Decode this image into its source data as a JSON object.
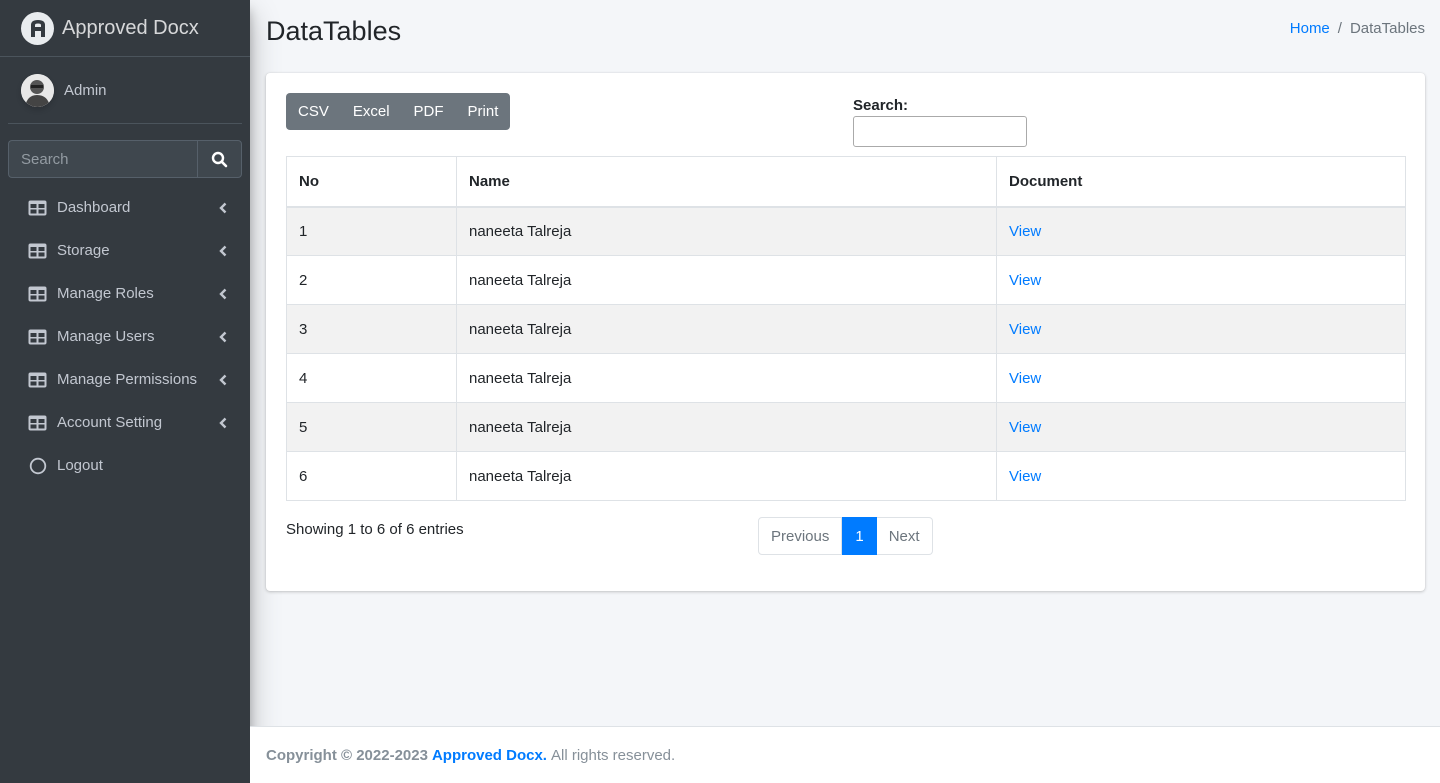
{
  "sidebar": {
    "brand": {
      "name": "Approved Docx",
      "logo_icon": "brand-logo-icon"
    },
    "user": {
      "name": "Admin",
      "avatar_icon": "user-avatar"
    },
    "search": {
      "placeholder": "Search",
      "icon": "search-icon"
    },
    "items": [
      {
        "label": "Dashboard",
        "icon": "table-icon",
        "has_submenu": true
      },
      {
        "label": "Storage",
        "icon": "table-icon",
        "has_submenu": true
      },
      {
        "label": "Manage Roles",
        "icon": "table-icon",
        "has_submenu": true
      },
      {
        "label": "Manage Users",
        "icon": "table-icon",
        "has_submenu": true
      },
      {
        "label": "Manage Permissions",
        "icon": "table-icon",
        "has_submenu": true
      },
      {
        "label": "Account Setting",
        "icon": "table-icon",
        "has_submenu": true
      },
      {
        "label": "Logout",
        "icon": "circle-icon",
        "has_submenu": false
      }
    ]
  },
  "header": {
    "title": "DataTables",
    "breadcrumb": {
      "home": "Home",
      "separator": "/",
      "current": "DataTables"
    }
  },
  "toolbar": {
    "buttons": [
      "CSV",
      "Excel",
      "PDF",
      "Print"
    ]
  },
  "search": {
    "label": "Search:",
    "value": ""
  },
  "table": {
    "columns": [
      "No",
      "Name",
      "Document"
    ],
    "rows": [
      {
        "no": "1",
        "name": "naneeta Talreja",
        "document": "View"
      },
      {
        "no": "2",
        "name": "naneeta Talreja",
        "document": "View"
      },
      {
        "no": "3",
        "name": "naneeta Talreja",
        "document": "View"
      },
      {
        "no": "4",
        "name": "naneeta Talreja",
        "document": "View"
      },
      {
        "no": "5",
        "name": "naneeta Talreja",
        "document": "View"
      },
      {
        "no": "6",
        "name": "naneeta Talreja",
        "document": "View"
      }
    ]
  },
  "info": "Showing 1 to 6 of 6 entries",
  "pagination": {
    "previous": "Previous",
    "current": "1",
    "next": "Next"
  },
  "footer": {
    "copyright": "Copyright © 2022-2023",
    "brand": "Approved Docx.",
    "rights": "All rights reserved."
  },
  "colors": {
    "sidebar_bg": "#343a40",
    "accent": "#007bff",
    "content_bg": "#f4f6f9",
    "button_bg": "#6c757d"
  }
}
